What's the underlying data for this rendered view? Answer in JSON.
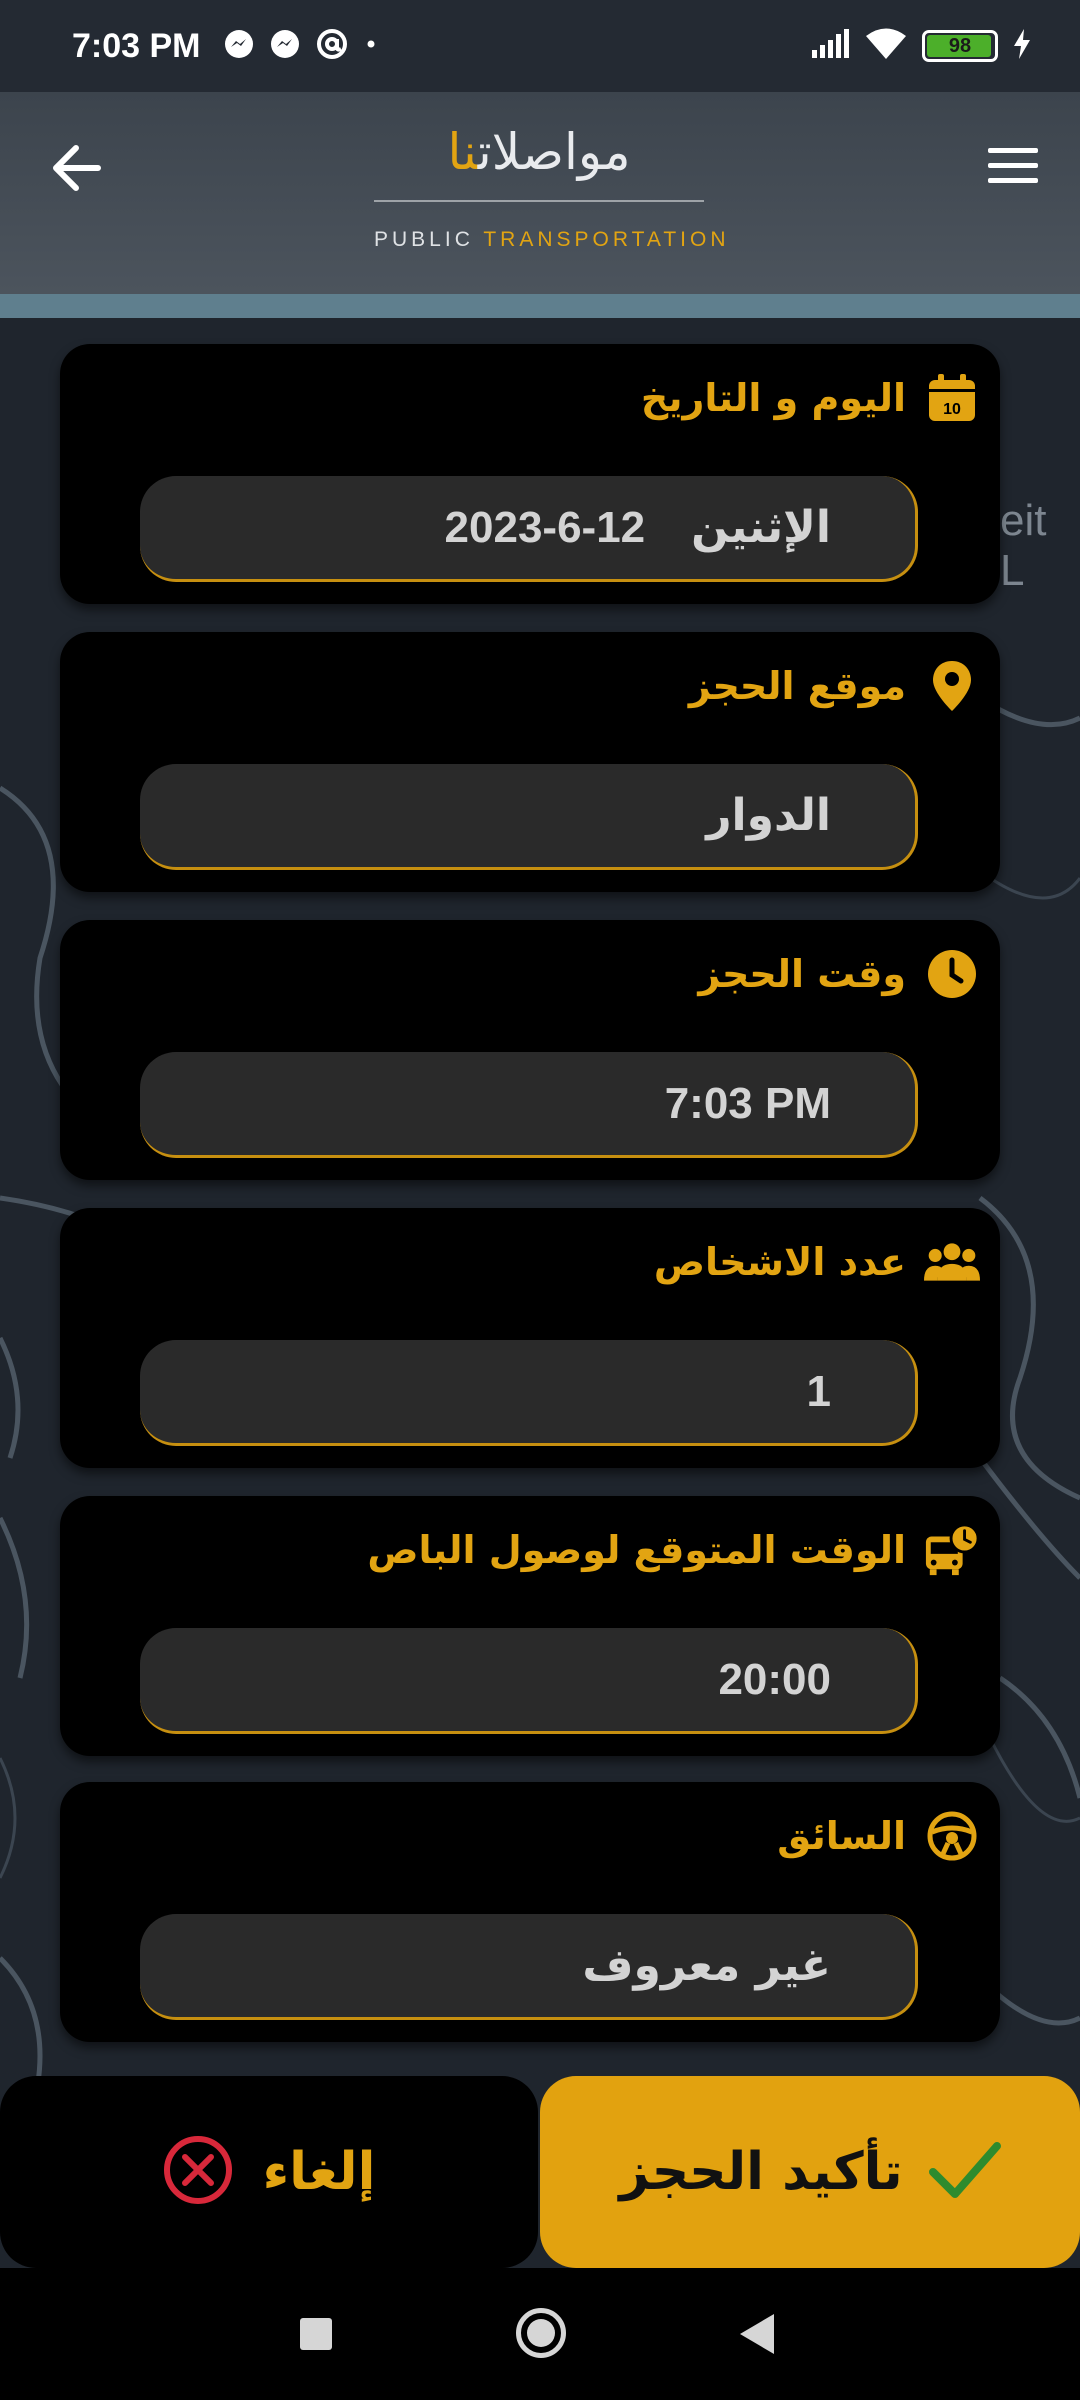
{
  "status_bar": {
    "time": "7:03 PM",
    "left_icons": [
      "messenger-icon",
      "messenger-icon",
      "at-sign-icon",
      "dot-icon"
    ],
    "right_icons": [
      "signal-icon",
      "wifi-icon",
      "battery-icon",
      "charging-icon"
    ],
    "battery": "98"
  },
  "header": {
    "logo_ar_main": "مواصلات",
    "logo_ar_accent": "نا",
    "logo_en_main": "PUBLIC ",
    "logo_en_accent": "TRANSPORTATION",
    "back_icon": "arrow-left-icon",
    "menu_icon": "hamburger-menu-icon"
  },
  "booking": {
    "date": {
      "label": "اليوم و التاريخ",
      "icon": "calendar-icon",
      "day": "الإثنين",
      "value": "2023-6-12"
    },
    "location": {
      "label": "موقع الحجز",
      "icon": "location-pin-icon",
      "value": "الدوار"
    },
    "time": {
      "label": "وقت الحجز",
      "icon": "clock-icon",
      "value": "7:03 PM"
    },
    "persons": {
      "label": "عدد الاشخاص",
      "icon": "people-icon",
      "value": "1"
    },
    "arrival": {
      "label": "الوقت المتوقع لوصول الباص",
      "icon": "bus-clock-icon",
      "value": "20:00"
    },
    "driver": {
      "label": "السائق",
      "icon": "steering-wheel-icon",
      "value": "غير معروف"
    }
  },
  "actions": {
    "cancel_label": "إلغاء",
    "confirm_label": "تأكيد الحجز"
  },
  "colors": {
    "accent": "#e2a412",
    "card_bg": "#000000",
    "field_bg": "#2a2a2a",
    "cancel_icon": "#d8283a",
    "check_icon": "#2e8b2e"
  }
}
